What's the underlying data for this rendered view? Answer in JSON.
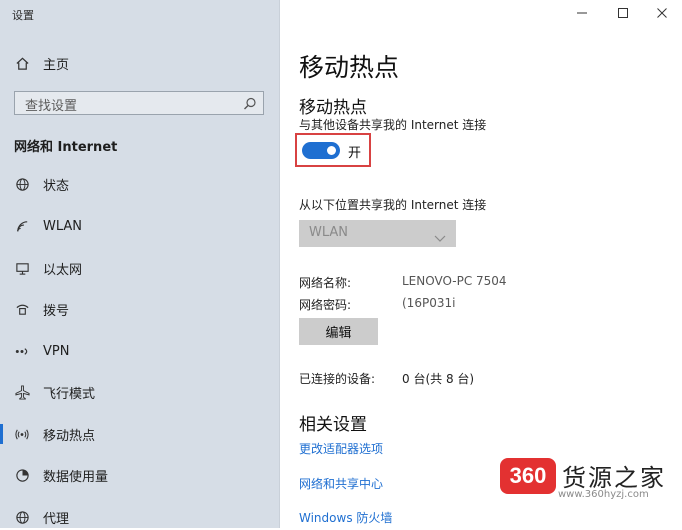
{
  "app_title": "设置",
  "sidebar": {
    "home": {
      "label": "主页",
      "icon": "home-icon"
    },
    "search": {
      "placeholder": "查找设置"
    },
    "section": "网络和 Internet",
    "items": [
      {
        "label": "状态",
        "icon": "globe-icon"
      },
      {
        "label": "WLAN",
        "icon": "wifi-icon"
      },
      {
        "label": "以太网",
        "icon": "ethernet-icon"
      },
      {
        "label": "拨号",
        "icon": "dialup-icon"
      },
      {
        "label": "VPN",
        "icon": "vpn-icon"
      },
      {
        "label": "飞行模式",
        "icon": "airplane-icon"
      },
      {
        "label": "移动热点",
        "icon": "hotspot-icon",
        "selected": true
      },
      {
        "label": "数据使用量",
        "icon": "data-usage-icon"
      },
      {
        "label": "代理",
        "icon": "proxy-globe-icon"
      }
    ]
  },
  "main": {
    "title": "移动热点",
    "hotspot": {
      "heading": "移动热点",
      "description": "与其他设备共享我的 Internet 连接",
      "toggle_state": "开",
      "toggle_on": true
    },
    "share_from": {
      "label": "从以下位置共享我的 Internet 连接",
      "selected": "WLAN"
    },
    "network_name": {
      "label": "网络名称:",
      "value": "LENOVO-PC 7504"
    },
    "network_password": {
      "label": "网络密码:",
      "value": "(16P031i"
    },
    "edit_label": "编辑",
    "connected": {
      "label": "已连接的设备:",
      "value": "0 台(共 8 台)"
    },
    "related": {
      "heading": "相关设置",
      "links": [
        "更改适配器选项",
        "网络和共享中心",
        "Windows 防火墙"
      ]
    }
  },
  "watermark": {
    "badge": "360",
    "text": "货源之家",
    "url": "www.360hyzj.com"
  },
  "colors": {
    "accent": "#1f6fd1",
    "sidebar_bg": "#d6dde6",
    "highlight_border": "#d84242",
    "badge": "#e33131"
  }
}
